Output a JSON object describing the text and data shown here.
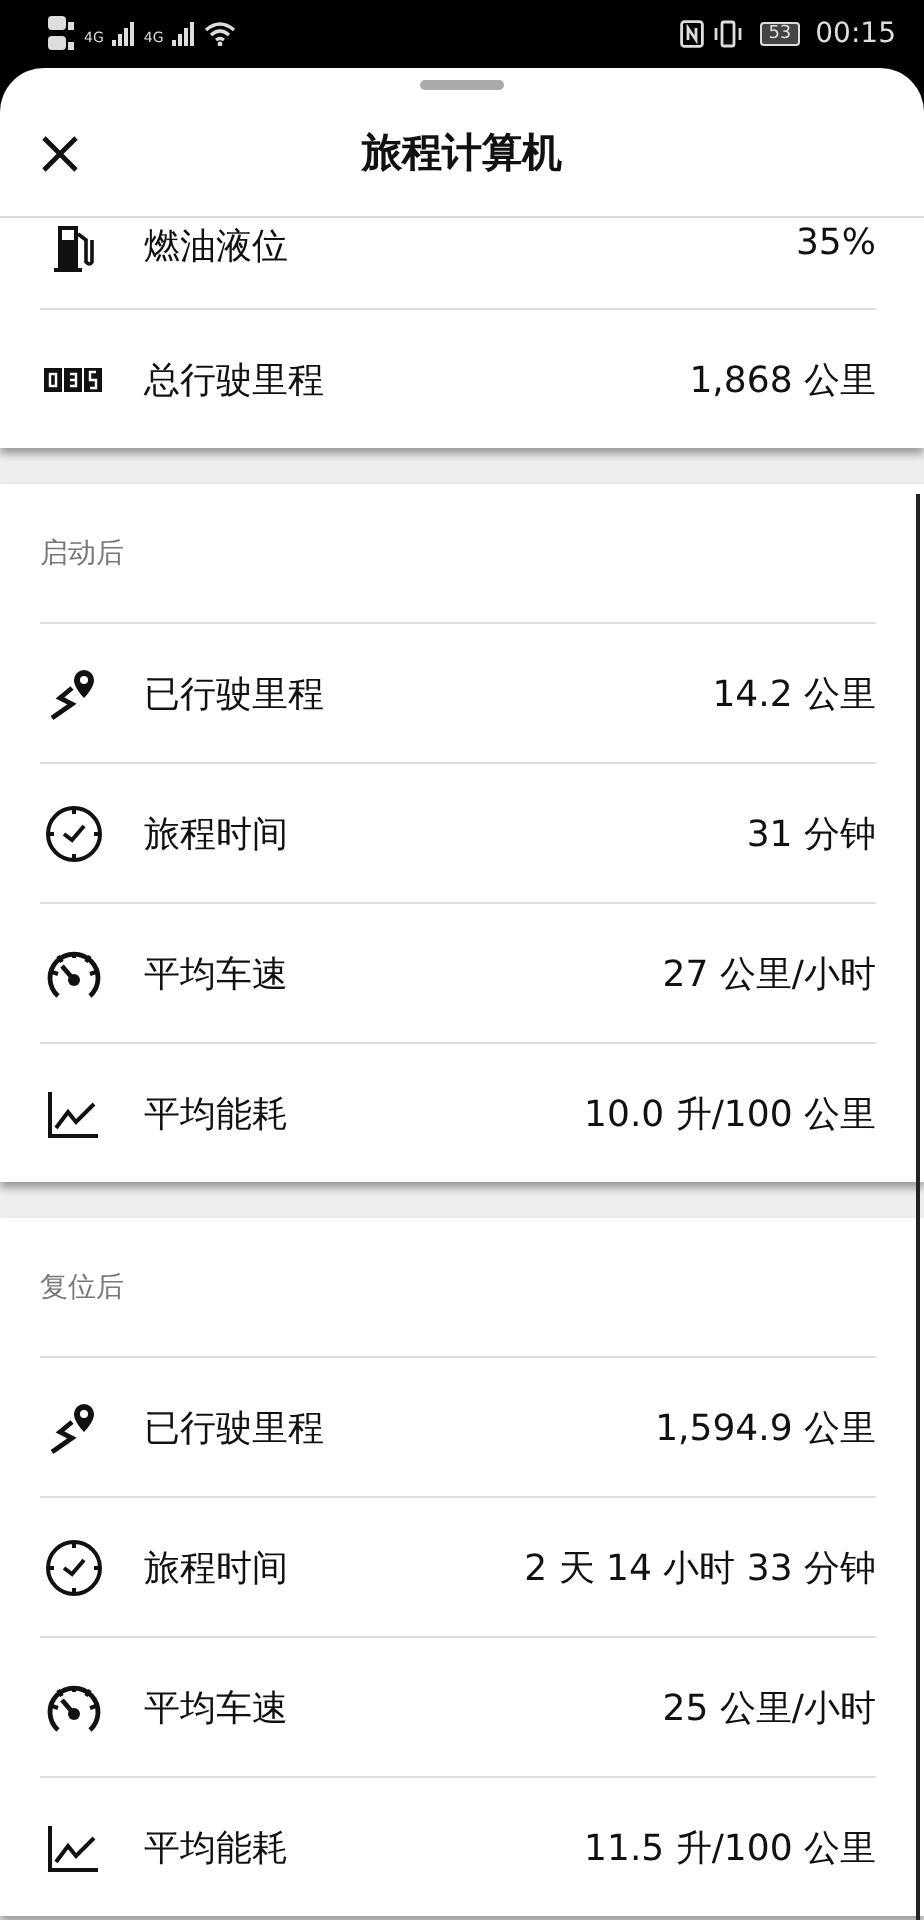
{
  "status_bar": {
    "network_1": "4G",
    "network_2": "4G",
    "battery": "53",
    "time": "00:15"
  },
  "title": "旅程计算机",
  "top_items": [
    {
      "kind": "fuel",
      "label": "燃油液位",
      "value": "35%"
    },
    {
      "kind": "odometer",
      "label": "总行驶里程",
      "value": "1,868 公里"
    }
  ],
  "sections": [
    {
      "title": "启动后",
      "items": [
        {
          "kind": "route",
          "label": "已行驶里程",
          "value": "14.2 公里"
        },
        {
          "kind": "clock",
          "label": "旅程时间",
          "value": "31 分钟"
        },
        {
          "kind": "speed",
          "label": "平均车速",
          "value": "27 公里/小时"
        },
        {
          "kind": "consumption",
          "label": "平均能耗",
          "value": "10.0 升/100 公里"
        }
      ]
    },
    {
      "title": "复位后",
      "items": [
        {
          "kind": "route",
          "label": "已行驶里程",
          "value": "1,594.9 公里"
        },
        {
          "kind": "clock",
          "label": "旅程时间",
          "value": "2 天 14 小时 33 分钟"
        },
        {
          "kind": "speed",
          "label": "平均车速",
          "value": "25 公里/小时"
        },
        {
          "kind": "consumption",
          "label": "平均能耗",
          "value": "11.5 升/100 公里"
        }
      ]
    }
  ]
}
